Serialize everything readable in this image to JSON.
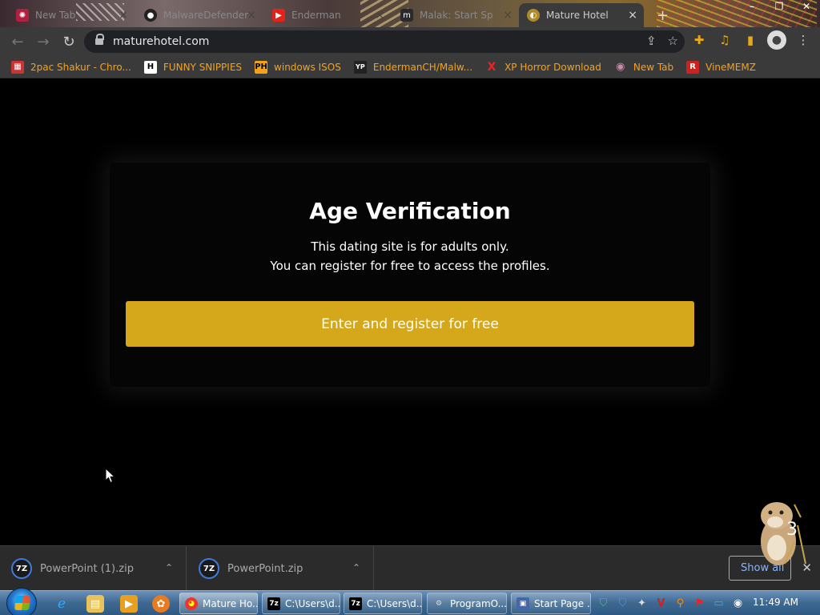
{
  "browser": {
    "tabs": [
      {
        "title": "New Tab",
        "active": false
      },
      {
        "title": "MalwareDefender",
        "active": false
      },
      {
        "title": "Enderman",
        "active": false
      },
      {
        "title": "Malak: Start Sp",
        "active": false
      },
      {
        "title": "Mature Hotel",
        "active": true
      }
    ],
    "new_tab_glyph": "+",
    "close_glyph": "×",
    "window_controls": [
      "–",
      "❐",
      "✕"
    ],
    "url": "maturehotel.com",
    "bookmarks": [
      {
        "label": "2pac Shakur - Chro...",
        "icon_text": "▦"
      },
      {
        "label": "FUNNY SNIPPIES",
        "icon_text": "H"
      },
      {
        "label": "windows ISOS",
        "icon_text": "PH"
      },
      {
        "label": "EndermanCH/Malw...",
        "icon_text": "YP"
      },
      {
        "label": "XP Horror Download",
        "icon_text": "X"
      },
      {
        "label": "New Tab",
        "icon_text": "◉"
      },
      {
        "label": "VineMEMZ",
        "icon_text": "R"
      }
    ]
  },
  "page": {
    "heading": "Age Verification",
    "line1": "This dating site is for adults only.",
    "line2": "You can register for free to access the profiles.",
    "cta_label": "Enter and register for free",
    "accent_color": "#d4a81a"
  },
  "downloads": {
    "items": [
      {
        "name": "PowerPoint (1).zip",
        "icon_text": "7Z"
      },
      {
        "name": "PowerPoint.zip",
        "icon_text": "7Z"
      }
    ],
    "show_all_label": "Show all",
    "close_glyph": "✕"
  },
  "taskbar": {
    "tasks": [
      {
        "label": "Mature Ho...",
        "icon_text": "◕"
      },
      {
        "label": "C:\\Users\\d...",
        "icon_text": "7z"
      },
      {
        "label": "C:\\Users\\d...",
        "icon_text": "7z"
      },
      {
        "label": "ProgramO...",
        "icon_text": "⚙"
      },
      {
        "label": "Start Page ...",
        "icon_text": "▣"
      }
    ],
    "clock": "11:49 AM"
  }
}
